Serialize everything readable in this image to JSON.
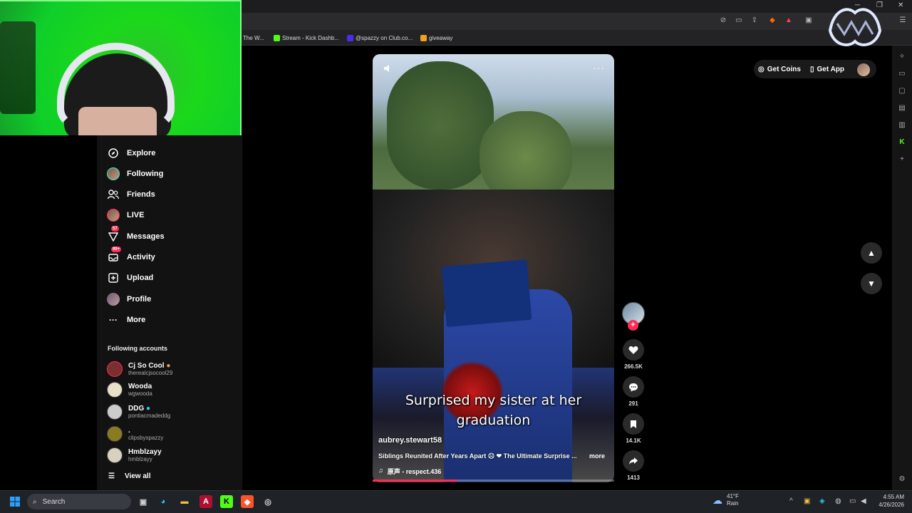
{
  "bookmarks": [
    {
      "label": "The W...",
      "color": "#444444"
    },
    {
      "label": "Stream - Kick Dashb...",
      "color": "#53fc18"
    },
    {
      "label": "@spazzy on Club.co...",
      "color": "#4a2cf0"
    },
    {
      "label": "giveaway",
      "color": "#f0a020"
    }
  ],
  "sidebar": {
    "items": [
      {
        "label": "Explore",
        "icon": "compass-icon"
      },
      {
        "label": "Following",
        "icon": "avatar-icon"
      },
      {
        "label": "Friends",
        "icon": "friends-icon"
      },
      {
        "label": "LIVE",
        "icon": "live-avatar-icon"
      },
      {
        "label": "Messages",
        "icon": "paper-plane-icon",
        "badge": "57"
      },
      {
        "label": "Activity",
        "icon": "inbox-icon",
        "badge": "99+"
      },
      {
        "label": "Upload",
        "icon": "plus-square-icon"
      },
      {
        "label": "Profile",
        "icon": "profile-avatar-icon"
      },
      {
        "label": "More",
        "icon": "ellipsis-icon"
      }
    ],
    "following_title": "Following accounts",
    "accounts": [
      {
        "name": "Cj So Cool",
        "handle": "therealcjsocool29",
        "color": "#7a3030"
      },
      {
        "name": "Wooda",
        "handle": "wgwooda",
        "color": "#e8e0c8"
      },
      {
        "name": "DDG",
        "handle": "pontiacmadeddg",
        "color": "#cccccc",
        "verified": true
      },
      {
        "name": ".",
        "handle": "clipsbyspazzy",
        "color": "#8a7a20"
      },
      {
        "name": "Hmblzayy",
        "handle": "hmblzayy",
        "color": "#d8d0c0"
      }
    ],
    "view_all": "View all"
  },
  "video": {
    "caption": "Surprised my sister at her graduation",
    "author": "aubrey.stewart58",
    "description": "Siblings Reunited After Years Apart ☹ ❤ The Ultimate Surprise ...",
    "more": "more",
    "sound": "原声 - respect.436",
    "progress": 0.35
  },
  "actions": {
    "likes": "266.5K",
    "comments": "291",
    "saves": "14.1K",
    "shares": "1413"
  },
  "header": {
    "get_coins": "Get Coins",
    "get_app": "Get App"
  },
  "taskbar": {
    "search": "Search",
    "temp": "41°F",
    "weather": "Rain",
    "time": "4:55 AM",
    "date": "4/26/2026"
  },
  "colors": {
    "accent": "#fe2c55",
    "kick": "#53fc18"
  }
}
